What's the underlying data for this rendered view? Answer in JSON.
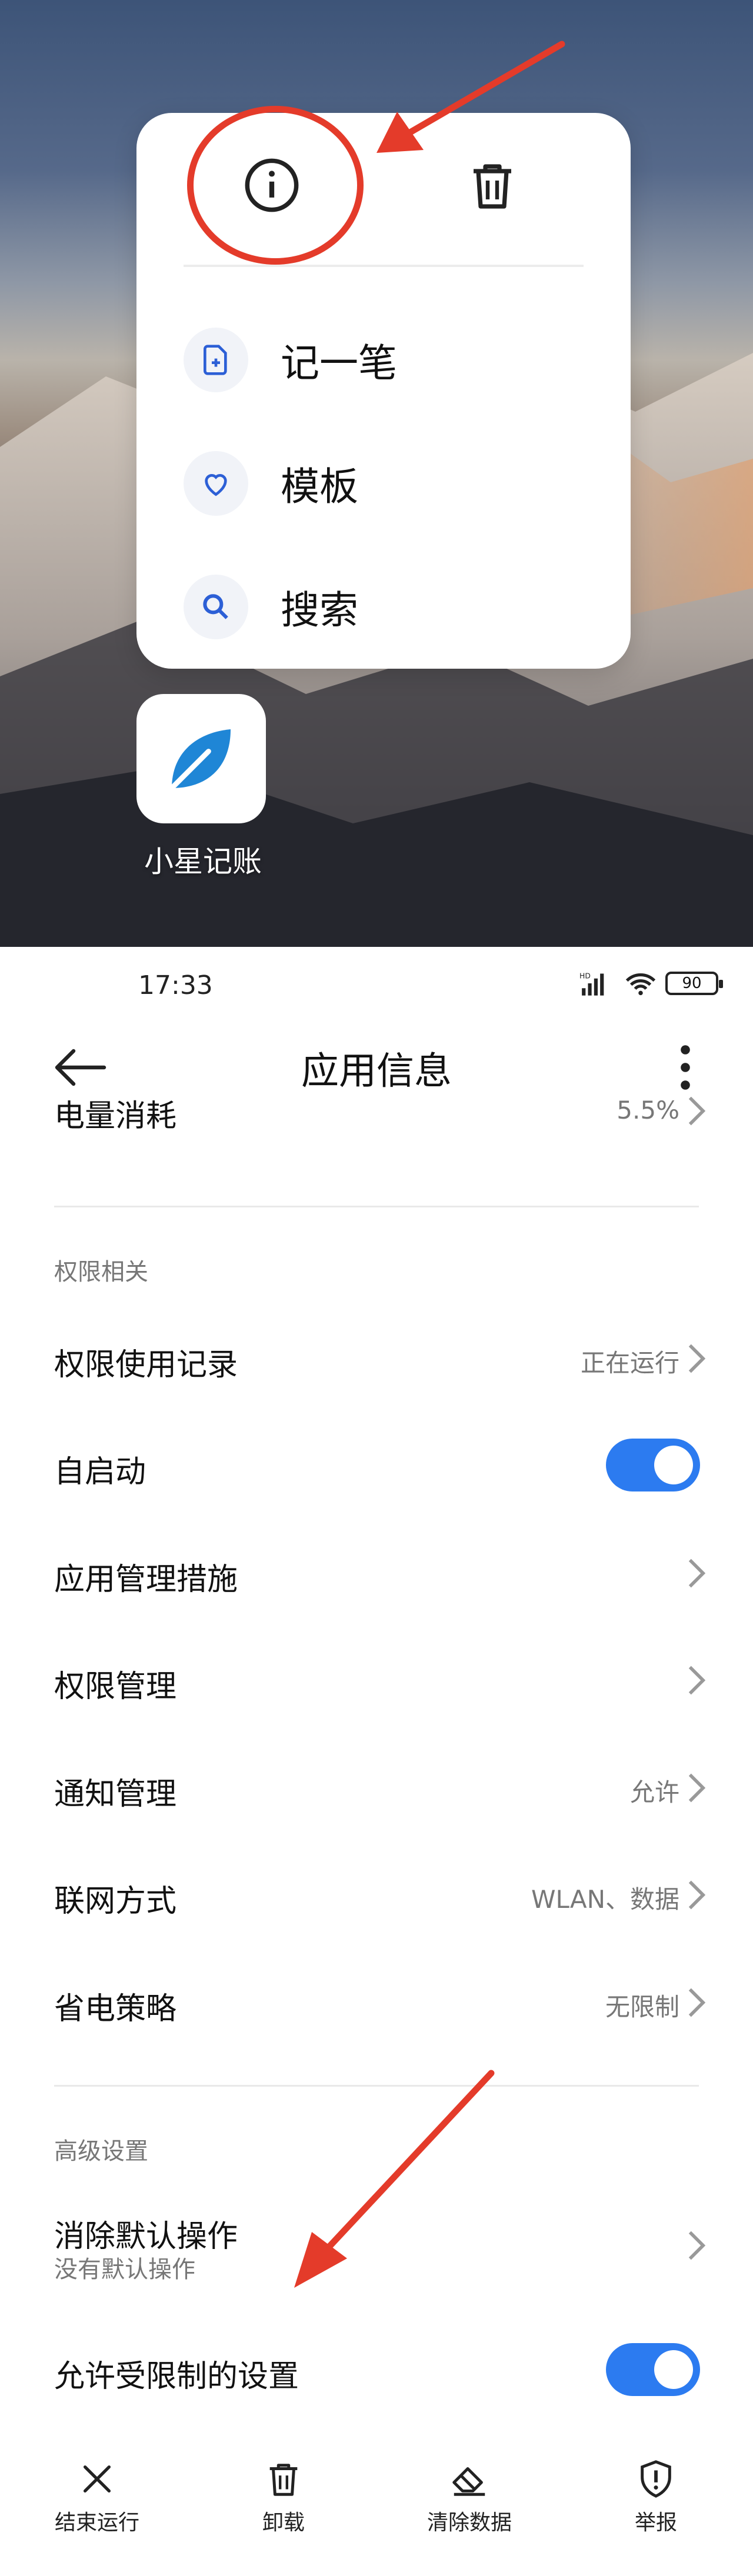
{
  "popup": {
    "items": [
      {
        "label": "记一笔",
        "icon": "note-add-icon"
      },
      {
        "label": "模板",
        "icon": "heart-icon"
      },
      {
        "label": "搜索",
        "icon": "search-icon"
      }
    ]
  },
  "app": {
    "name": "小星记账"
  },
  "status_bar": {
    "time": "17:33",
    "battery": "90"
  },
  "header": {
    "title": "应用信息"
  },
  "rows": {
    "battery_usage": {
      "label": "电量消耗",
      "value": "5.5%"
    },
    "permission_section": "权限相关",
    "permission_history": {
      "label": "权限使用记录",
      "value": "正在运行"
    },
    "autostart": {
      "label": "自启动",
      "on": true
    },
    "app_management": {
      "label": "应用管理措施"
    },
    "permission_management": {
      "label": "权限管理"
    },
    "notification": {
      "label": "通知管理",
      "value": "允许"
    },
    "network": {
      "label": "联网方式",
      "value": "WLAN、数据"
    },
    "power_saving": {
      "label": "省电策略",
      "value": "无限制"
    },
    "advanced_section": "高级设置",
    "clear_default": {
      "label": "消除默认操作",
      "sub": "没有默认操作"
    },
    "restricted_settings": {
      "label": "允许受限制的设置",
      "on": true
    }
  },
  "bottom_bar": [
    {
      "label": "结束运行",
      "icon": "close-icon"
    },
    {
      "label": "卸载",
      "icon": "trash-icon"
    },
    {
      "label": "清除数据",
      "icon": "eraser-icon"
    },
    {
      "label": "举报",
      "icon": "report-shield-icon"
    }
  ],
  "colors": {
    "accent": "#2c7bf0",
    "annotation": "#e43b2a"
  }
}
